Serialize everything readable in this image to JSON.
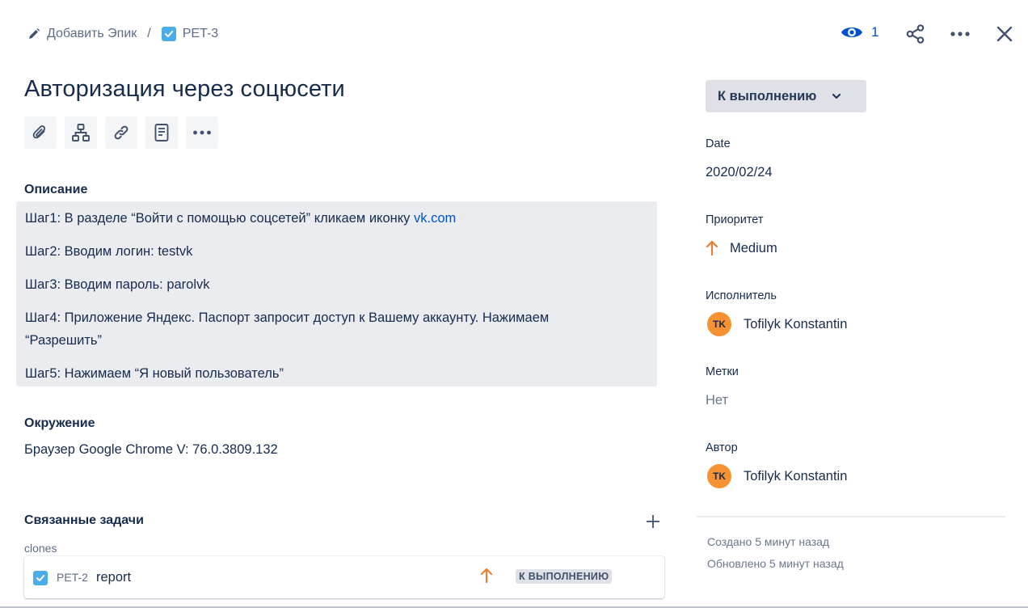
{
  "breadcrumb": {
    "add_epic_label": "Добавить Эпик",
    "separator": "/",
    "issue_key": "PET-3"
  },
  "header": {
    "watchers_count": "1"
  },
  "issue": {
    "title": "Авторизация через соцюсети"
  },
  "toolbar": {
    "icons": [
      "paperclip-icon",
      "child-issues-icon",
      "link-icon",
      "page-icon",
      "more-icon"
    ]
  },
  "description": {
    "label": "Описание",
    "steps": [
      {
        "text": "Шаг1: В разделе “Войти с помощью соцсетей” кликаем иконку ",
        "link": "vk.com"
      },
      {
        "text": "Шаг2: Вводим логин: testvk"
      },
      {
        "text": "Шаг3: Вводим пароль: parolvk"
      },
      {
        "text": "Шаг4: Приложение Яндекс. Паспорт запросит доступ к Вашему аккаунту. Нажимаем “Разрешить”"
      },
      {
        "text": "Шаг5: Нажимаем “Я новый пользователь”"
      }
    ]
  },
  "environment": {
    "label": "Окружение",
    "value": "Браузер Google Chrome V: 76.0.3809.132"
  },
  "linked_issues": {
    "label": "Связанные задачи",
    "relation": "clones",
    "items": [
      {
        "key": "PET-2",
        "summary": "report",
        "status": "К ВЫПОЛНЕНИЮ",
        "priority": "Medium"
      }
    ]
  },
  "sidebar": {
    "status": "К выполнению",
    "date_label": "Date",
    "date_value": "2020/02/24",
    "priority_label": "Приоритет",
    "priority_value": "Medium",
    "assignee_label": "Исполнитель",
    "assignee_initials": "TK",
    "assignee_name": "Tofilyk Konstantin",
    "labels_label": "Метки",
    "labels_value": "Нет",
    "reporter_label": "Автор",
    "reporter_initials": "TK",
    "reporter_name": "Tofilyk Konstantin",
    "created": "Создано 5 минут назад",
    "updated": "Обновлено 5 минут назад"
  },
  "colors": {
    "accent": "#0052cc",
    "priority_medium": "#e97f33",
    "avatar": "#f79232",
    "description_bg": "#ebecf0",
    "checkbox": "#4bade8"
  }
}
